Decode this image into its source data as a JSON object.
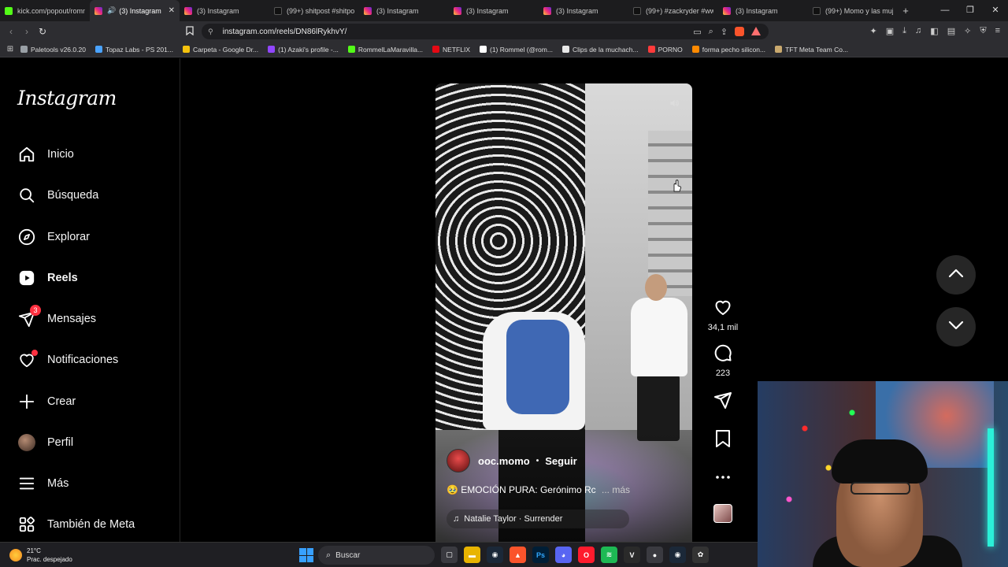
{
  "browser": {
    "tabs": [
      {
        "title": "kick.com/popout/romm",
        "favicon": "kick",
        "active": false
      },
      {
        "title": "(3) Instagram",
        "favicon": "instagram",
        "active": true,
        "audio": true
      },
      {
        "title": "(3) Instagram",
        "favicon": "instagram",
        "active": false
      },
      {
        "title": "(99+) shitpost #shitpos",
        "favicon": "tiktok",
        "active": false
      },
      {
        "title": "(3) Instagram",
        "favicon": "instagram",
        "active": false
      },
      {
        "title": "(3) Instagram",
        "favicon": "instagram",
        "active": false
      },
      {
        "title": "(3) Instagram",
        "favicon": "instagram",
        "active": false
      },
      {
        "title": "(99+) #zackryder #ww",
        "favicon": "tiktok",
        "active": false
      },
      {
        "title": "(3) Instagram",
        "favicon": "instagram",
        "active": false
      },
      {
        "title": "(99+) Momo y las muje",
        "favicon": "tiktok",
        "active": false
      }
    ],
    "new_tab": "+",
    "url": "instagram.com/reels/DN86lRykhvY/",
    "bookmarks": [
      {
        "label": "Paletools v26.0.20",
        "color": "#9aa0a6"
      },
      {
        "label": "Topaz Labs - PS 201...",
        "color": "#4aa3ff"
      },
      {
        "label": "Carpeta - Google Dr...",
        "color": "#f4c20d"
      },
      {
        "label": "(1) Azaki's profile -...",
        "color": "#9146ff"
      },
      {
        "label": "RommelLaMaravilla...",
        "color": "#53fc18"
      },
      {
        "label": "NETFLIX",
        "color": "#e50914"
      },
      {
        "label": "(1) Rommel (@rom...",
        "color": "#ffffff"
      },
      {
        "label": "Clips de la muchach...",
        "color": "#e8e8e8"
      },
      {
        "label": "PORNO",
        "color": "#ff3b3b"
      },
      {
        "label": "forma pecho silicon...",
        "color": "#ff8a00"
      },
      {
        "label": "TFT Meta Team Co...",
        "color": "#c9a96e"
      }
    ]
  },
  "instagram": {
    "logo": "Instagram",
    "nav": [
      {
        "label": "Inicio",
        "icon": "home-icon"
      },
      {
        "label": "Búsqueda",
        "icon": "search-icon"
      },
      {
        "label": "Explorar",
        "icon": "compass-icon"
      },
      {
        "label": "Reels",
        "icon": "reels-icon",
        "active": true
      },
      {
        "label": "Mensajes",
        "icon": "messenger-icon",
        "badge": "3"
      },
      {
        "label": "Notificaciones",
        "icon": "heart-icon",
        "dot": true
      },
      {
        "label": "Crear",
        "icon": "plus-icon"
      },
      {
        "label": "Perfil",
        "icon": "avatar"
      },
      {
        "label": "Más",
        "icon": "menu-icon"
      },
      {
        "label": "También de Meta",
        "icon": "grid-icon"
      }
    ],
    "reel": {
      "username": "ooc.momo",
      "follow": "Seguir",
      "caption": "EMOCIÓN PURA: Gerónimo Rc",
      "caption_more": "... más",
      "caption_emoji": "🥹",
      "music": "Natalie Taylor · Surrender",
      "likes": "34,1 mil",
      "comments": "223"
    }
  },
  "taskbar": {
    "temp": "21°C",
    "weather": "Prac. despejado",
    "search": "Buscar"
  }
}
